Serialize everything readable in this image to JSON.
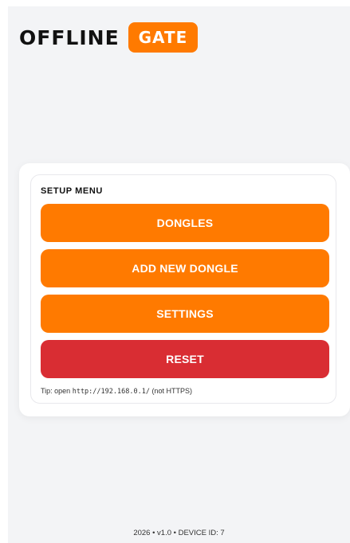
{
  "header": {
    "brand_word": "OFFLINE",
    "brand_badge": "GATE"
  },
  "setup_menu": {
    "title": "SETUP MENU",
    "buttons": [
      {
        "label": "DONGLES"
      },
      {
        "label": "ADD NEW DONGLE"
      },
      {
        "label": "SETTINGS"
      },
      {
        "label": "RESET"
      }
    ],
    "tip_prefix": "Tip: open ",
    "tip_url": "http://192.168.0.1/",
    "tip_suffix": " (not HTTPS)"
  },
  "footer": {
    "text": "2026 • v1.0 • DEVICE ID: 7"
  },
  "colors": {
    "accent": "#ff7a00",
    "danger": "#d92d33",
    "background": "#f3f4f6"
  }
}
